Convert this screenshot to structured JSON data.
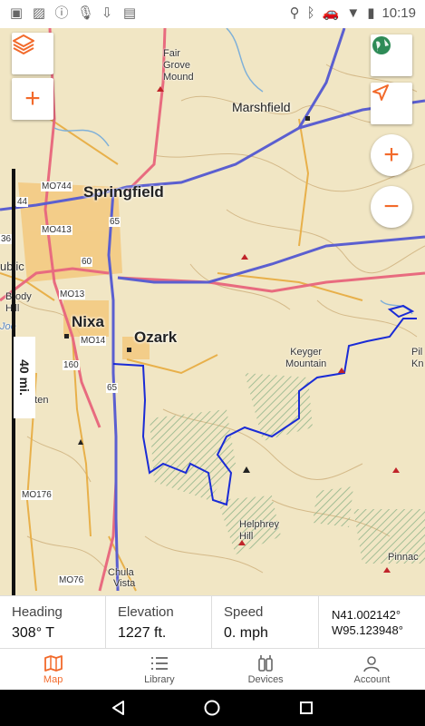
{
  "status_bar": {
    "time": "10:19",
    "left_icons": [
      "image-icon",
      "photo-icon",
      "info-icon",
      "microphone-icon",
      "download-icon",
      "sd-card-icon"
    ],
    "right_icons": [
      "location-icon",
      "bluetooth-icon",
      "car-icon",
      "wifi-icon",
      "battery-icon"
    ]
  },
  "map": {
    "labels": {
      "fair_grove": "Fair\nGrove\nMound",
      "marshfield": "Marshfield",
      "springfield": "Springfield",
      "nixa": "Nixa",
      "ozark": "Ozark",
      "brody_hill": "Brody\nHill",
      "keyger_mountain": "Keyger\nMountain",
      "hooten_hill": "Hooten\nHill",
      "helphrey_hill": "Helphrey\nHill",
      "pinnacle": "Pinnac",
      "pil": "Pil\nKn",
      "chula": "Chula",
      "vista": "Vista",
      "republic": "ublic",
      "lake": "Joe"
    },
    "road_labels": {
      "mo744": "MO744",
      "r44": "44",
      "mo413": "MO413",
      "r60": "60",
      "r65a": "65",
      "mo13": "MO13",
      "mo14": "MO14",
      "r160a": "160",
      "r65b": "65",
      "mo176": "MO176",
      "mo76": "MO76",
      "r60b": "60",
      "r36": "36"
    },
    "scale_label": "40 mi.",
    "buttons": [
      "layers-icon",
      "add-waypoint-icon",
      "globe-icon",
      "locate-arrow-icon",
      "zoom-in-icon",
      "zoom-out-icon"
    ]
  },
  "info": {
    "heading_label": "Heading",
    "heading_value": "308° T",
    "elevation_label": "Elevation",
    "elevation_value": "1227 ft.",
    "speed_label": "Speed",
    "speed_value": "0. mph",
    "lat": "N41.002142°",
    "lon": "W95.123948°"
  },
  "tabs": [
    {
      "label": "Map",
      "icon": "map-icon",
      "active": true
    },
    {
      "label": "Library",
      "icon": "list-icon",
      "active": false
    },
    {
      "label": "Devices",
      "icon": "devices-icon",
      "active": false
    },
    {
      "label": "Account",
      "icon": "account-icon",
      "active": false
    }
  ],
  "nav": [
    "back-icon",
    "home-icon",
    "recents-icon"
  ],
  "colors": {
    "accent": "#f26a2b",
    "track": "#1a2bd6",
    "interstate": "#5b5fd0",
    "highway": "#e86b7f"
  }
}
